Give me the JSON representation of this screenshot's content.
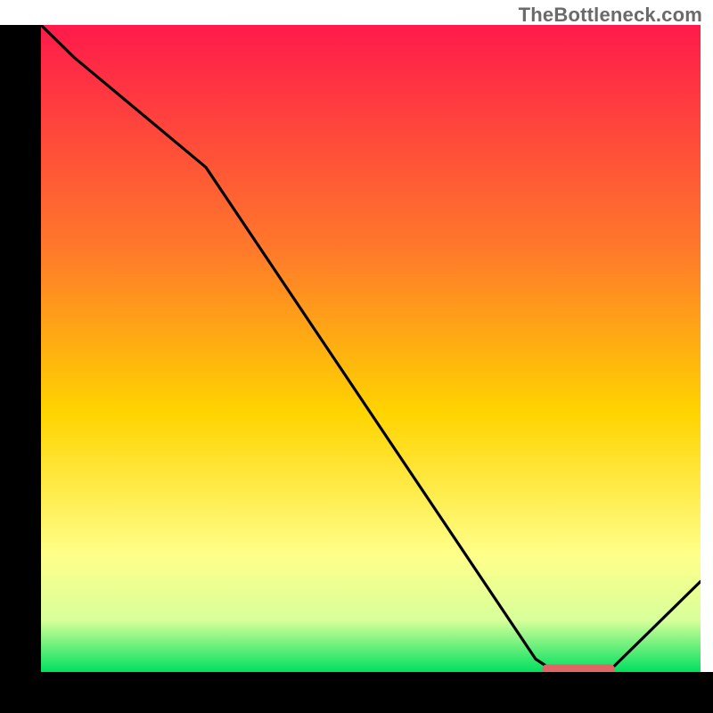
{
  "watermark": "TheBottleneck.com",
  "colors": {
    "gradient_top": "#ff1a4b",
    "gradient_mid1": "#ff8a2a",
    "gradient_mid2": "#ffe000",
    "gradient_low": "#ffffa8",
    "gradient_bottom": "#00e060",
    "curve": "#000000",
    "marker": "#e06666",
    "axis": "#000000"
  },
  "chart_data": {
    "type": "line",
    "x": [
      0.0,
      0.05,
      0.25,
      0.75,
      0.78,
      0.86,
      1.0
    ],
    "y": [
      1.0,
      0.95,
      0.78,
      0.02,
      0.0,
      0.0,
      0.14
    ],
    "xlim": [
      0,
      1
    ],
    "ylim": [
      0,
      1
    ],
    "xlabel": "",
    "ylabel": "",
    "title": "",
    "marker": {
      "x_start": 0.76,
      "x_end": 0.87,
      "y": 0.005
    },
    "background_gradient_stops": [
      {
        "offset": 0.0,
        "color": "#ff1a4b"
      },
      {
        "offset": 0.35,
        "color": "#ff7a2a"
      },
      {
        "offset": 0.6,
        "color": "#ffd400"
      },
      {
        "offset": 0.82,
        "color": "#ffff8a"
      },
      {
        "offset": 0.92,
        "color": "#d8ff9a"
      },
      {
        "offset": 1.0,
        "color": "#00e060"
      }
    ]
  }
}
